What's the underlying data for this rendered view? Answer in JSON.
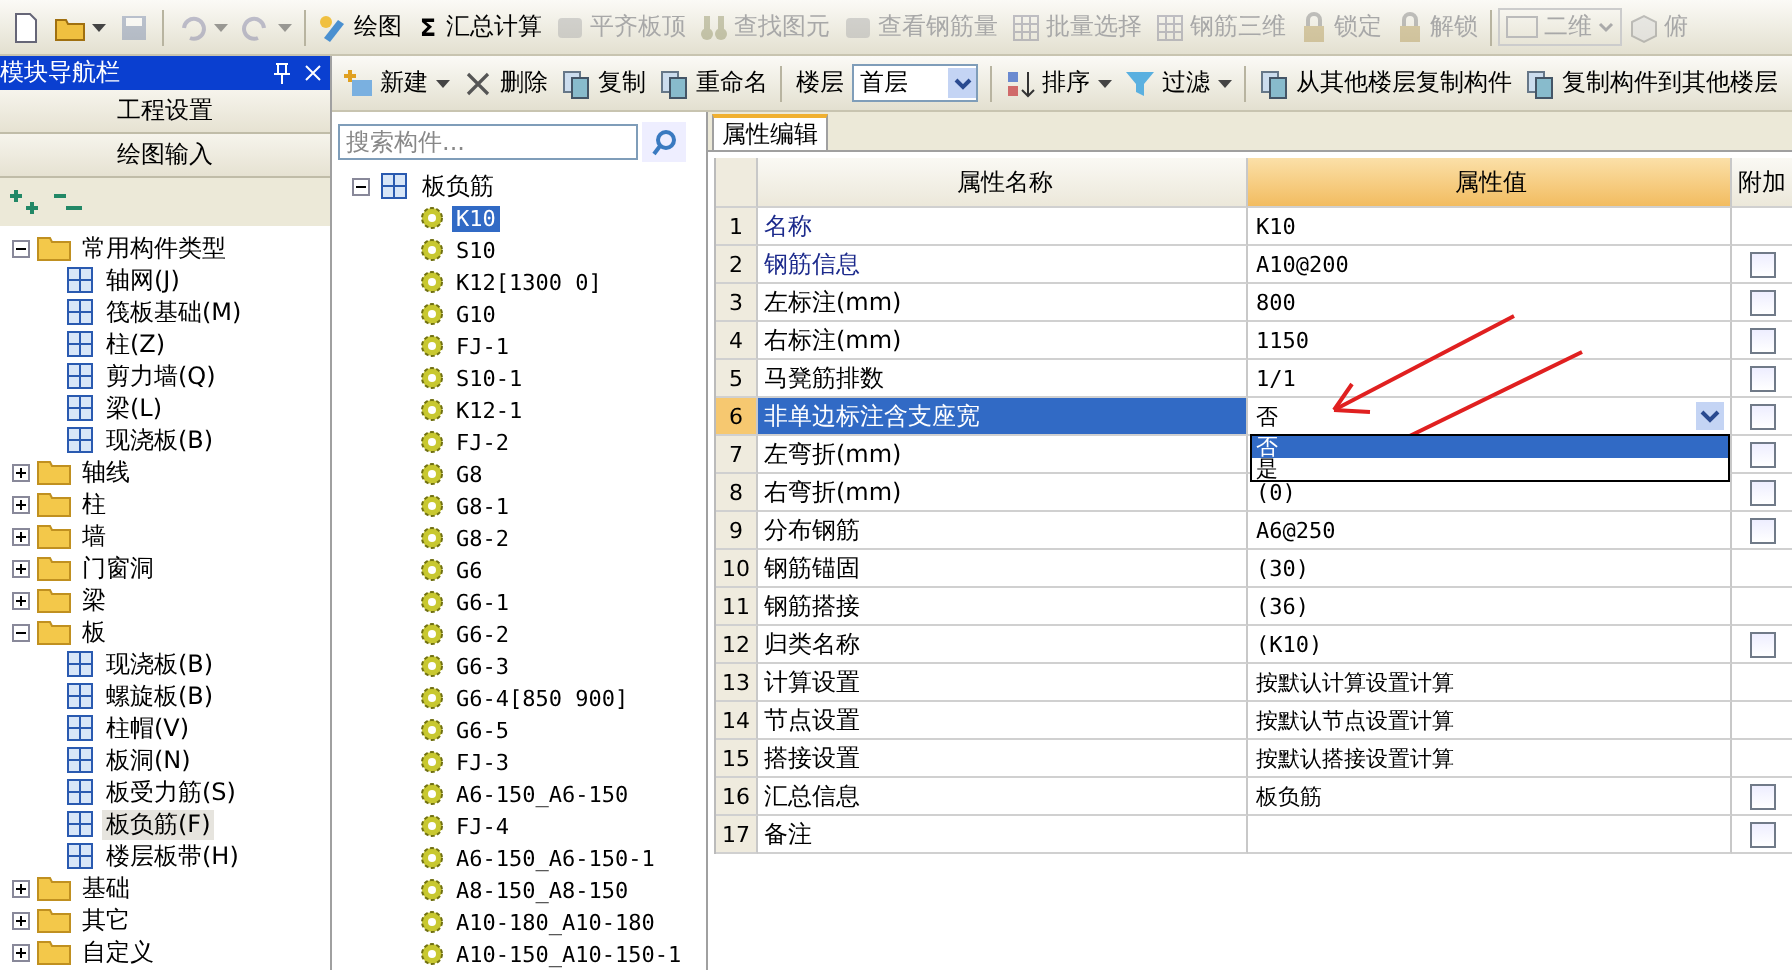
{
  "toolbar": [
    {
      "disabled": false
    },
    {
      "disabled": false,
      "dropdown": true
    },
    {
      "disabled": true
    },
    {
      "disabled": true,
      "dropdown": true,
      "separator_before": true
    },
    {
      "disabled": true,
      "dropdown": true
    },
    {
      "label": "绘图",
      "disabled": false,
      "separator_before": true
    },
    {
      "glyph": "Σ",
      "label": "汇总计算",
      "disabled": false
    },
    {
      "label": "平齐板顶",
      "disabled": true
    },
    {
      "label": "查找图元",
      "disabled": true
    },
    {
      "label": "查看钢筋量",
      "disabled": true
    },
    {
      "label": "批量选择",
      "disabled": true
    },
    {
      "label": "钢筋三维",
      "disabled": true
    },
    {
      "label": "锁定",
      "disabled": true
    },
    {
      "label": "解锁",
      "disabled": true
    },
    {
      "kind": "select",
      "label": "二维",
      "disabled": true,
      "separator_before": true
    },
    {
      "label": "俯",
      "disabled": true
    }
  ],
  "navigator": {
    "title": "模块导航栏",
    "sections": [
      "工程设置",
      "绘图输入"
    ],
    "tree": [
      {
        "label": "常用构件类型",
        "kind": "folder",
        "expanded": true,
        "selected": false,
        "children": [
          {
            "label": "轴网(J)",
            "kind": "item",
            "selected": false
          },
          {
            "label": "筏板基础(M)",
            "kind": "item",
            "selected": false
          },
          {
            "label": "柱(Z)",
            "kind": "item",
            "selected": false
          },
          {
            "label": "剪力墙(Q)",
            "kind": "item",
            "selected": false
          },
          {
            "label": "梁(L)",
            "kind": "item",
            "selected": false
          },
          {
            "label": "现浇板(B)",
            "kind": "item",
            "selected": false
          }
        ]
      },
      {
        "label": "轴线",
        "kind": "folder",
        "expanded": false,
        "selected": false
      },
      {
        "label": "柱",
        "kind": "folder",
        "expanded": false,
        "selected": false
      },
      {
        "label": "墙",
        "kind": "folder",
        "expanded": false,
        "selected": false
      },
      {
        "label": "门窗洞",
        "kind": "folder",
        "expanded": false,
        "selected": false
      },
      {
        "label": "梁",
        "kind": "folder",
        "expanded": false,
        "selected": false
      },
      {
        "label": "板",
        "kind": "folder",
        "expanded": true,
        "selected": false,
        "children": [
          {
            "label": "现浇板(B)",
            "kind": "item",
            "selected": false
          },
          {
            "label": "螺旋板(B)",
            "kind": "item",
            "selected": false
          },
          {
            "label": "柱帽(V)",
            "kind": "item",
            "selected": false
          },
          {
            "label": "板洞(N)",
            "kind": "item",
            "selected": false
          },
          {
            "label": "板受力筋(S)",
            "kind": "item",
            "selected": false
          },
          {
            "label": "板负筋(F)",
            "kind": "item",
            "selected": true
          },
          {
            "label": "楼层板带(H)",
            "kind": "item",
            "selected": false
          }
        ]
      },
      {
        "label": "基础",
        "kind": "folder",
        "expanded": false,
        "selected": false
      },
      {
        "label": "其它",
        "kind": "folder",
        "expanded": false,
        "selected": false
      },
      {
        "label": "自定义",
        "kind": "folder",
        "expanded": false,
        "selected": false
      }
    ]
  },
  "component_toolbar": [
    {
      "kind": "button",
      "label": "新建",
      "dropdown": true
    },
    {
      "kind": "button",
      "label": "删除"
    },
    {
      "kind": "button",
      "label": "复制"
    },
    {
      "kind": "button",
      "label": "重命名"
    },
    {
      "kind": "label",
      "label": "楼层",
      "separator_before": true
    },
    {
      "kind": "select",
      "label": "首层"
    },
    {
      "kind": "button",
      "label": "排序",
      "dropdown": true,
      "separator_before": true
    },
    {
      "kind": "button",
      "label": "过滤",
      "dropdown": true
    },
    {
      "kind": "button",
      "label": "从其他楼层复制构件",
      "separator_before": true
    },
    {
      "kind": "button",
      "label": "复制构件到其他楼层"
    }
  ],
  "component_list": {
    "search": {
      "placeholder": "搜索构件..."
    },
    "root": {
      "label": "板负筋",
      "expanded": true,
      "children": [
        {
          "label": "K10",
          "selected": true
        },
        {
          "label": "S10",
          "selected": false
        },
        {
          "label": "K12[1300 0]",
          "selected": false
        },
        {
          "label": "G10",
          "selected": false
        },
        {
          "label": "FJ-1",
          "selected": false
        },
        {
          "label": "S10-1",
          "selected": false
        },
        {
          "label": "K12-1",
          "selected": false
        },
        {
          "label": "FJ-2",
          "selected": false
        },
        {
          "label": "G8",
          "selected": false
        },
        {
          "label": "G8-1",
          "selected": false
        },
        {
          "label": "G8-2",
          "selected": false
        },
        {
          "label": "G6",
          "selected": false
        },
        {
          "label": "G6-1",
          "selected": false
        },
        {
          "label": "G6-2",
          "selected": false
        },
        {
          "label": "G6-3",
          "selected": false
        },
        {
          "label": "G6-4[850 900]",
          "selected": false
        },
        {
          "label": "G6-5",
          "selected": false
        },
        {
          "label": "FJ-3",
          "selected": false
        },
        {
          "label": "A6-150_A6-150",
          "selected": false
        },
        {
          "label": "FJ-4",
          "selected": false
        },
        {
          "label": "A6-150_A6-150-1",
          "selected": false
        },
        {
          "label": "A8-150_A8-150",
          "selected": false
        },
        {
          "label": "A10-180_A10-180",
          "selected": false
        },
        {
          "label": "A10-150_A10-150-1",
          "selected": false
        }
      ]
    }
  },
  "properties": {
    "tab": "属性编辑",
    "columns": [
      "属性名称",
      "属性值",
      "附加"
    ],
    "rows": [
      {
        "no": "1",
        "name": "名称",
        "value": "K10",
        "required": true,
        "selected": false
      },
      {
        "no": "2",
        "name": "钢筋信息",
        "value": "A10@200",
        "required": true,
        "selected": false,
        "checked": false
      },
      {
        "no": "3",
        "name": "左标注(mm)",
        "value": "800",
        "required": false,
        "selected": false,
        "checked": false
      },
      {
        "no": "4",
        "name": "右标注(mm)",
        "value": "1150",
        "required": false,
        "selected": false,
        "checked": false
      },
      {
        "no": "5",
        "name": "马凳筋排数",
        "value": "1/1",
        "required": false,
        "selected": false,
        "checked": false
      },
      {
        "no": "6",
        "name": "非单边标注含支座宽",
        "value": "否",
        "required": false,
        "selected": true,
        "checked": false,
        "dropdown": [
          {
            "label": "否",
            "selected": true
          },
          {
            "label": "是",
            "selected": false
          }
        ]
      },
      {
        "no": "7",
        "name": "左弯折(mm)",
        "required": false,
        "selected": false,
        "checked": false
      },
      {
        "no": "8",
        "name": "右弯折(mm)",
        "value": "(0)",
        "required": false,
        "selected": false,
        "checked": false
      },
      {
        "no": "9",
        "name": "分布钢筋",
        "value": "A6@250",
        "required": false,
        "selected": false,
        "checked": false
      },
      {
        "no": "10",
        "name": "钢筋锚固",
        "value": "(30)",
        "required": false,
        "selected": false
      },
      {
        "no": "11",
        "name": "钢筋搭接",
        "value": "(36)",
        "required": false,
        "selected": false
      },
      {
        "no": "12",
        "name": "归类名称",
        "value": "(K10)",
        "required": false,
        "selected": false,
        "checked": false
      },
      {
        "no": "13",
        "name": "计算设置",
        "value": "按默认计算设置计算",
        "required": false,
        "selected": false
      },
      {
        "no": "14",
        "name": "节点设置",
        "value": "按默认节点设置计算",
        "required": false,
        "selected": false
      },
      {
        "no": "15",
        "name": "搭接设置",
        "value": "按默认搭接设置计算",
        "required": false,
        "selected": false
      },
      {
        "no": "16",
        "name": "汇总信息",
        "value": "板负筋",
        "required": false,
        "selected": false,
        "checked": false
      },
      {
        "no": "17",
        "name": "备注",
        "required": false,
        "selected": false,
        "checked": false
      }
    ]
  }
}
